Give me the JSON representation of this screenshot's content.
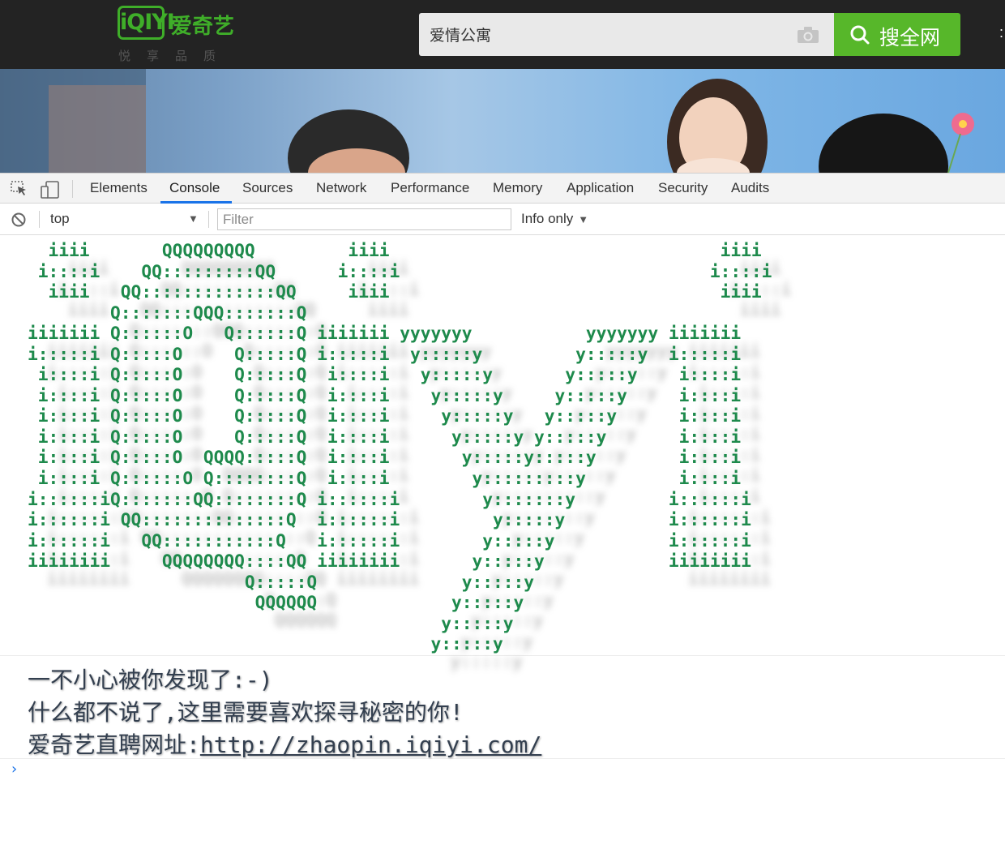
{
  "site": {
    "logo_text": "iQIYI",
    "logo_name": "爱奇艺",
    "slogan": "悦享品质",
    "search_value": "爱情公寓",
    "search_button_label": "搜全网",
    "brand_color": "#3fae29",
    "button_color": "#57b72a"
  },
  "devtools": {
    "tabs": [
      "Elements",
      "Console",
      "Sources",
      "Network",
      "Performance",
      "Memory",
      "Application",
      "Security",
      "Audits"
    ],
    "active_tab": "Console",
    "context": "top",
    "filter_placeholder": "Filter",
    "level": "Info only",
    "icons": [
      "inspect-element-icon",
      "device-toolbar-icon",
      "clear-console-icon"
    ]
  },
  "console": {
    "ascii_art": "  iiii       QQQQQQQQQ         iiii                                iiii\n i::::i    QQ:::::::::QQ      i::::i                              i::::i\n  iiii   QQ:::::::::::::QQ     iiii                                iiii\n        Q:::::::QQQ:::::::Q\niiiiiii Q::::::O   Q::::::Q iiiiiii yyyyyyy           yyyyyyy iiiiiii\ni:::::i Q:::::O     Q:::::Q i:::::i  y:::::y         y:::::y  i:::::i\n i::::i Q:::::O     Q:::::Q  i::::i   y:::::y       y:::::y    i::::i\n i::::i Q:::::O     Q:::::Q  i::::i    y:::::y     y:::::y     i::::i\n i::::i Q:::::O     Q:::::Q  i::::i     y:::::y   y:::::y      i::::i\n i::::i Q:::::O     Q:::::Q  i::::i      y:::::y y:::::y       i::::i\n i::::i Q:::::O  QQQQ:::::Q  i::::i       y:::::y:::::y        i::::i\n i::::i Q::::::O Q::::::::Q  i::::i        y:::::::::y         i::::i\ni::::::iQ:::::::QQ::::::::Q i::::::i        y:::::::y         i::::::i\ni::::::i QQ::::::::::::::Q  i::::::i         y:::::y          i::::::i\ni::::::i   QQ:::::::::::Q   i::::::i        y:::::y           i::::::i\niiiiiiii     QQQQQQQQ::::QQ iiiiiiii       y:::::y            iiiiiiii\n                     Q:::::Q              y:::::y\n                      QQQQQQ             y:::::y\n                                        y:::::y\n                                       y:::::y",
    "art_color": "#1e8a4c",
    "message_line1": "一不小心被你发现了:-)",
    "message_line2": "什么都不说了,这里需要喜欢探寻秘密的你!",
    "message_line3_prefix": "爱奇艺直聘网址:",
    "message_link": "http://zhaopin.iqiyi.com/",
    "prompt": "›"
  }
}
